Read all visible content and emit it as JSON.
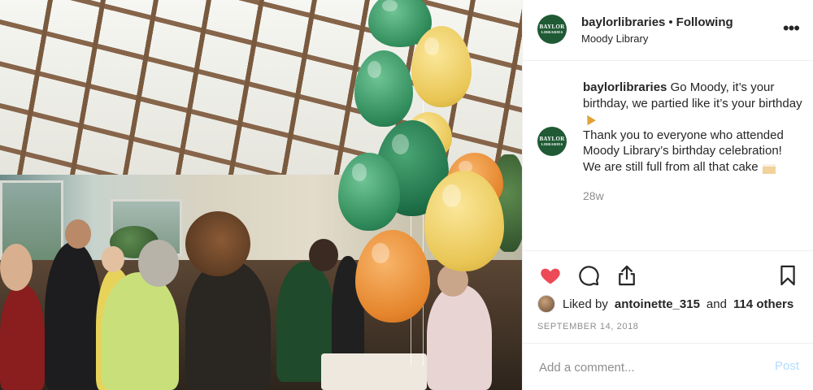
{
  "post": {
    "image_alt": "Photo of Moody Library birthday celebration with balloons and the Baylor bear mascot"
  },
  "header": {
    "username": "baylorlibraries",
    "separator": "•",
    "follow_status": "Following",
    "location": "Moody Library",
    "more_glyph": "•••",
    "avatar_line1": "BAYLOR",
    "avatar_line2": "LIBRARIES"
  },
  "caption": {
    "username": "baylorlibraries",
    "line1": "Go Moody, it’s your birthday, we partied like it’s your birthday",
    "line2": "Thank you to everyone who attended Moody Library’s birthday celebration! We are still full from all that cake",
    "timestamp": "28w"
  },
  "actions": {
    "like_icon": "heart-icon",
    "comment_icon": "comment-icon",
    "share_icon": "share-icon",
    "save_icon": "bookmark-icon",
    "like_color": "#ed4956"
  },
  "likes": {
    "prefix": "Liked by",
    "first_liker": "antoinette_315",
    "connector": "and",
    "others": "114 others"
  },
  "post_date": "SEPTEMBER 14, 2018",
  "comment": {
    "placeholder": "Add a comment...",
    "post_label": "Post",
    "post_color": "#b3dbff"
  }
}
